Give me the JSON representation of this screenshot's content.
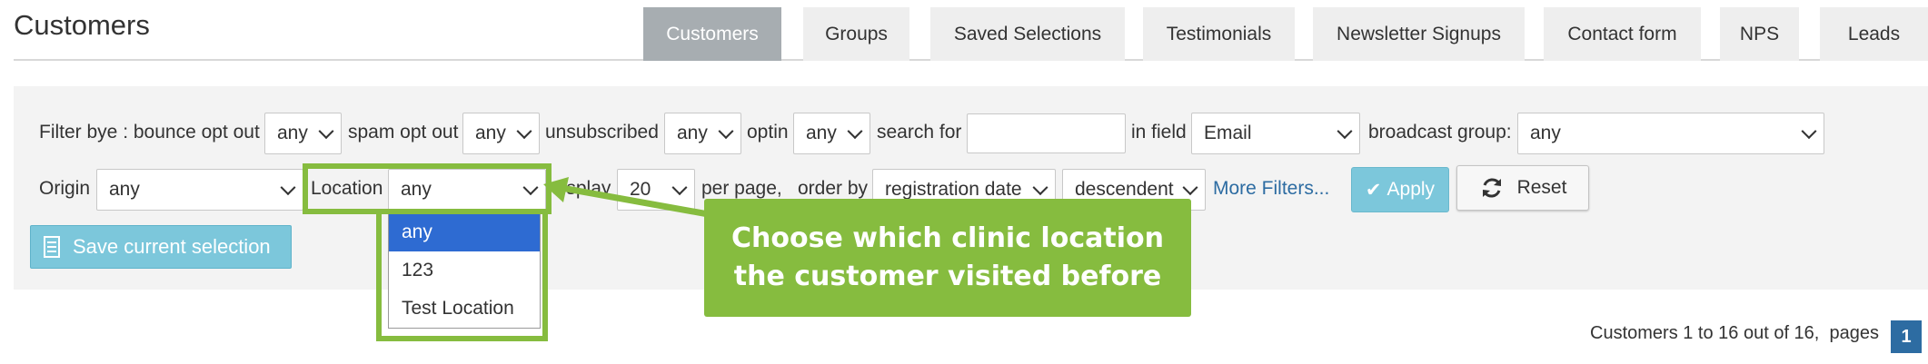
{
  "header": {
    "title": "Customers"
  },
  "tabs": [
    {
      "label": "Customers"
    },
    {
      "label": "Groups"
    },
    {
      "label": "Saved Selections"
    },
    {
      "label": "Testimonials"
    },
    {
      "label": "Newsletter Signups"
    },
    {
      "label": "Contact form"
    },
    {
      "label": "NPS"
    },
    {
      "label": "Leads"
    }
  ],
  "filters": {
    "bounce_label": "Filter bye : bounce opt out",
    "bounce_value": "any",
    "spam_label": "spam opt out",
    "spam_value": "any",
    "unsub_label": "unsubscribed",
    "unsub_value": "any",
    "optin_label": "optin",
    "optin_value": "any",
    "search_label": "search for",
    "search_value": "",
    "field_label": "in field",
    "field_value": "Email",
    "broadcast_label": "broadcast group:",
    "broadcast_value": "any",
    "origin_label": "Origin",
    "origin_value": "any",
    "location_label": "Location",
    "location_value": "any",
    "display_label": "display",
    "display_value": "20",
    "perpage_label": "per page,",
    "orderby_label": "order by",
    "orderby_value": "registration date",
    "direction_value": "descendent",
    "more_filters": "More Filters...",
    "apply": "Apply",
    "reset": "Reset"
  },
  "location_dropdown": {
    "options": [
      "any",
      "123",
      "Test Location"
    ],
    "selected_index": 0
  },
  "save_selection": "Save current selection",
  "callout": {
    "line1": "Choose which clinic location",
    "line2": "the customer visited before"
  },
  "pagination": {
    "summary": "Customers 1 to 16 out of 16,",
    "pages_label": "pages",
    "current_page": "1"
  },
  "colors": {
    "accent_green": "#86bc3f",
    "active_tab": "#a7adb1",
    "button_blue": "#7cc7db",
    "selected_option": "#2e6bd2",
    "page_badge": "#2d6ca2"
  }
}
